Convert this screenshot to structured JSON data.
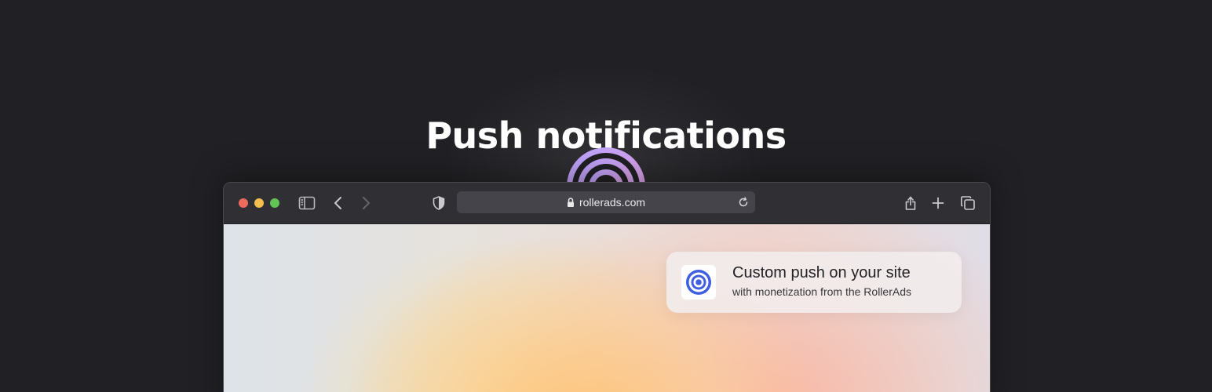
{
  "hero": {
    "title": "Push notifications"
  },
  "browser": {
    "address": {
      "url": "rollerads.com"
    },
    "toolbar_icons": [
      "sidebar-icon",
      "back-icon",
      "forward-icon",
      "shield-icon",
      "lock-icon",
      "reload-icon",
      "share-icon",
      "plus-icon",
      "tabs-icon"
    ]
  },
  "notification": {
    "title": "Custom push on your site",
    "subtitle": "with monetization from the RollerAds",
    "icon": "target-icon"
  },
  "colors": {
    "background": "#212024",
    "accent": "#3f5fe0",
    "ring_gradient_start": "#b6a4ff",
    "ring_gradient_end": "#f2a4e6"
  }
}
